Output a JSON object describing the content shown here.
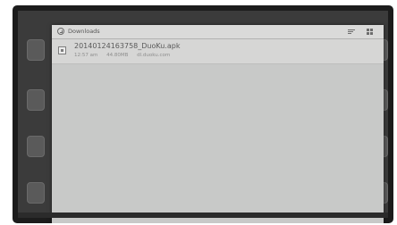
{
  "dialog": {
    "title": "Downloads",
    "items": [
      {
        "name": "20140124163758_DuoKu.apk",
        "time": "12:57 am",
        "size": "44.80MB",
        "source": "dl.duoku.com"
      }
    ]
  },
  "colors": {
    "dialog_bg": "#c8c9c8",
    "header_bg": "#dadad9",
    "item_bg": "#d6d6d5"
  },
  "icons": [
    "downloads-icon",
    "sort-icon",
    "grid-view-icon",
    "checkbox-icon"
  ]
}
